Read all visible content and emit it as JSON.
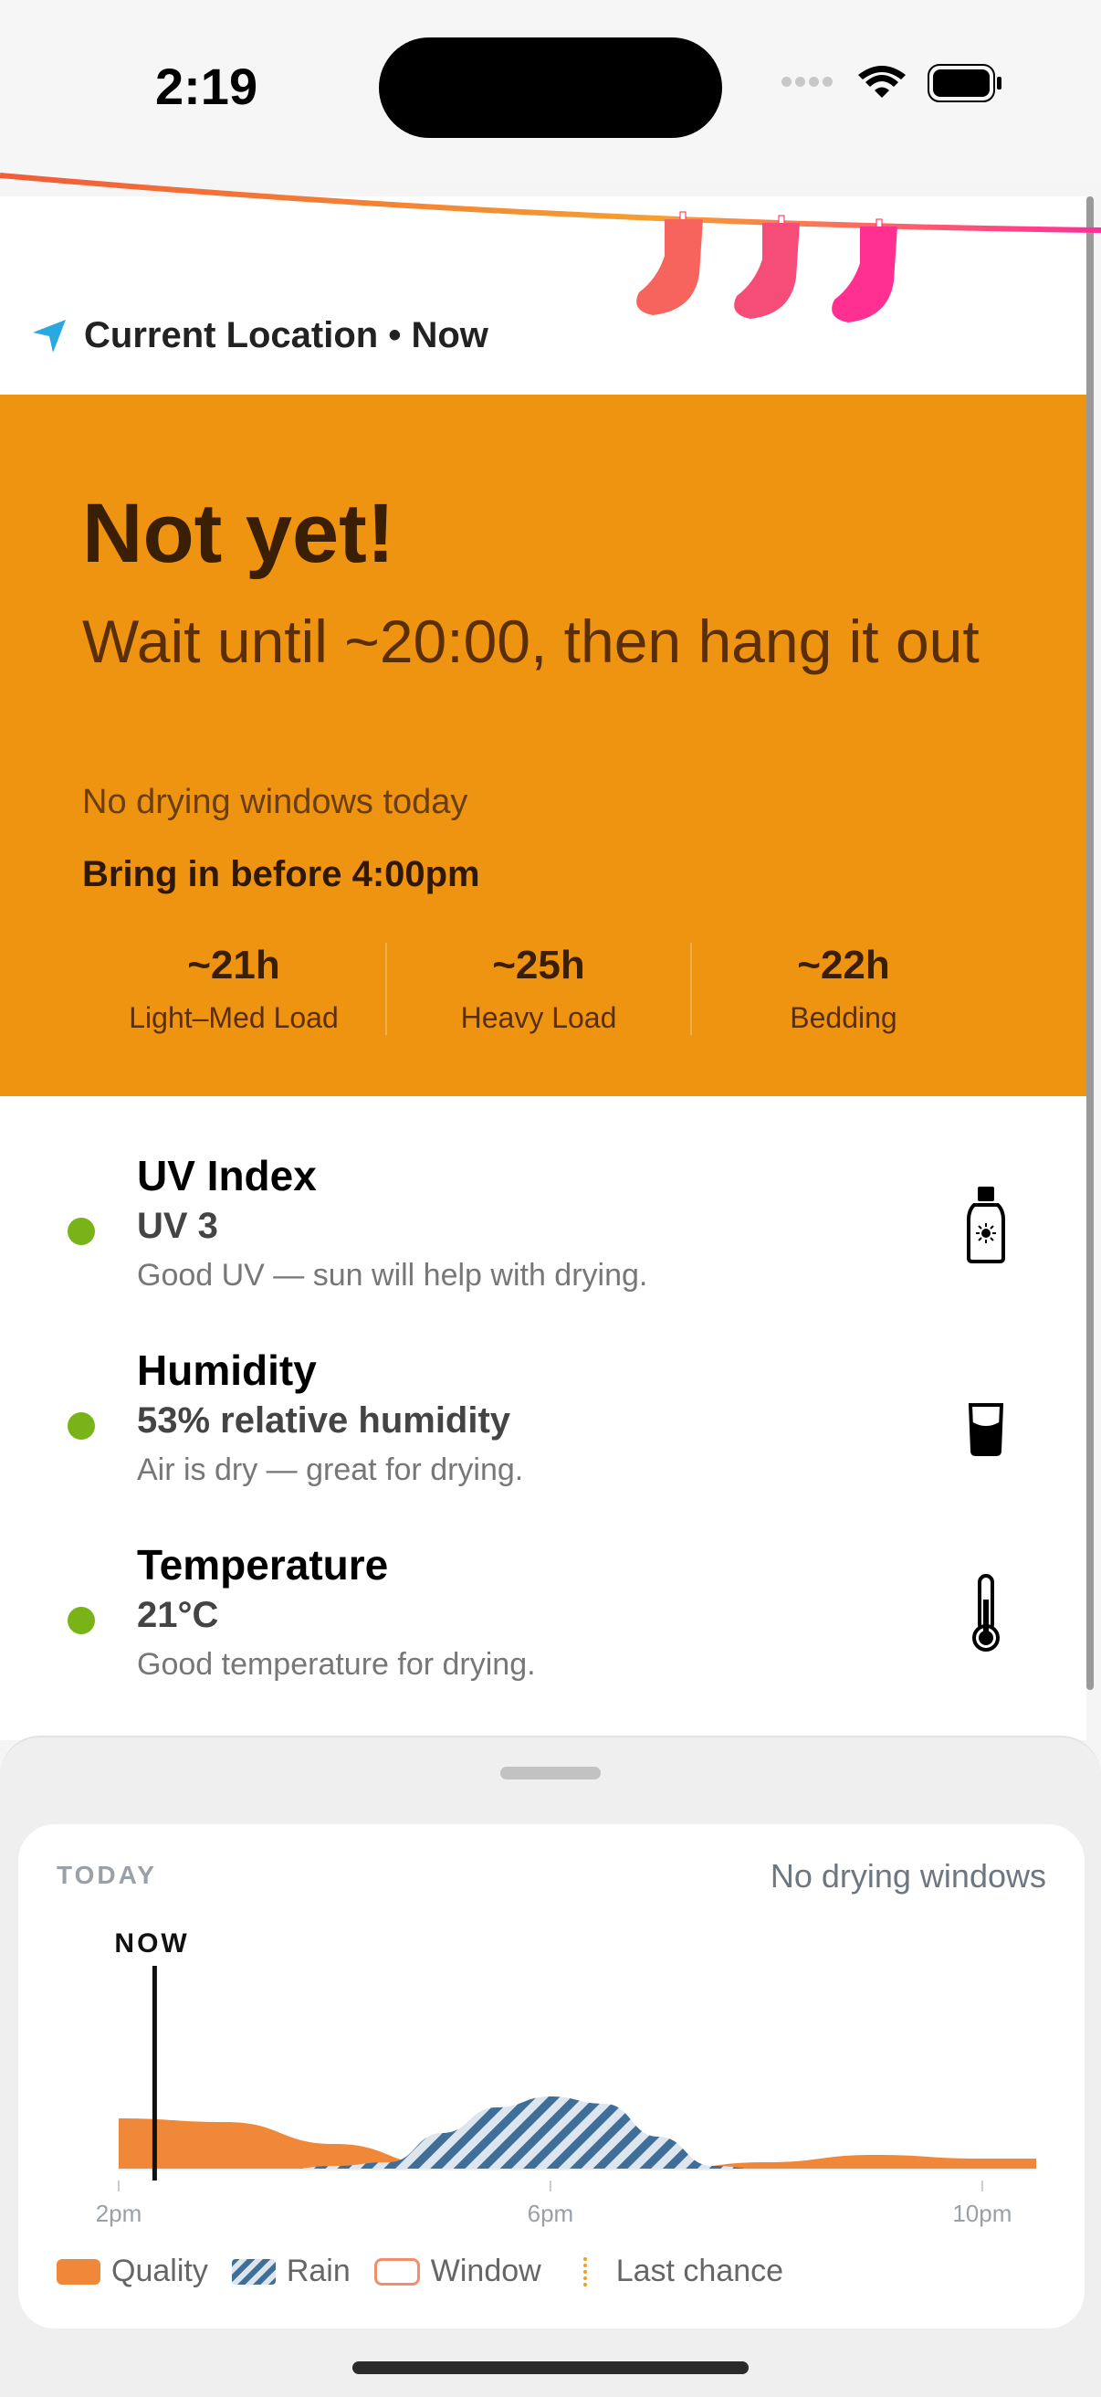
{
  "status_bar": {
    "time": "2:19"
  },
  "location": {
    "label": "Current Location • Now"
  },
  "verdict": {
    "headline": "Not yet!",
    "subhead": "Wait until ~20:00, then hang it out",
    "note": "No drying windows today",
    "bring_in": "Bring in before 4:00pm",
    "loads": [
      {
        "value": "~21h",
        "label": "Light–Med Load"
      },
      {
        "value": "~25h",
        "label": "Heavy Load"
      },
      {
        "value": "~22h",
        "label": "Bedding"
      }
    ]
  },
  "metrics": [
    {
      "title": "UV Index",
      "value": "UV 3",
      "desc": "Good UV — sun will help with drying.",
      "icon": "sunscreen-bottle-icon",
      "status_color": "#7ab317"
    },
    {
      "title": "Humidity",
      "value": "53% relative humidity",
      "desc": "Air is dry — great for drying.",
      "icon": "water-glass-icon",
      "status_color": "#7ab317"
    },
    {
      "title": "Temperature",
      "value": "21°C",
      "desc": "Good temperature for drying.",
      "icon": "thermometer-icon",
      "status_color": "#7ab317"
    }
  ],
  "forecast": {
    "today_label": "TODAY",
    "summary": "No drying windows",
    "now_label": "NOW",
    "legend": {
      "quality": "Quality",
      "rain": "Rain",
      "window": "Window",
      "last_chance": "Last chance"
    }
  },
  "chart_data": {
    "type": "area",
    "x_ticks": [
      "2pm",
      "6pm",
      "10pm"
    ],
    "x_range": [
      "2pm",
      "10:30pm"
    ],
    "now": "2:20pm",
    "series": [
      {
        "name": "Quality",
        "color": "#f0883a",
        "x": [
          "2pm",
          "3pm",
          "4pm",
          "5pm",
          "6pm",
          "7pm",
          "8pm",
          "9pm",
          "10pm",
          "10:30pm"
        ],
        "values": [
          0.7,
          0.65,
          0.35,
          0.05,
          0.0,
          0.0,
          0.1,
          0.2,
          0.15,
          0.15
        ]
      },
      {
        "name": "Rain",
        "color": "#3f6e99",
        "x": [
          "3:30pm",
          "4pm",
          "4:30pm",
          "5pm",
          "5:30pm",
          "6pm",
          "6:30pm",
          "7pm",
          "7:30pm",
          "8pm"
        ],
        "values": [
          0.0,
          0.05,
          0.1,
          0.5,
          0.85,
          1.0,
          0.9,
          0.45,
          0.05,
          0.0
        ]
      }
    ],
    "colors": {
      "banner": "#ee9410",
      "good": "#7ab317"
    }
  }
}
